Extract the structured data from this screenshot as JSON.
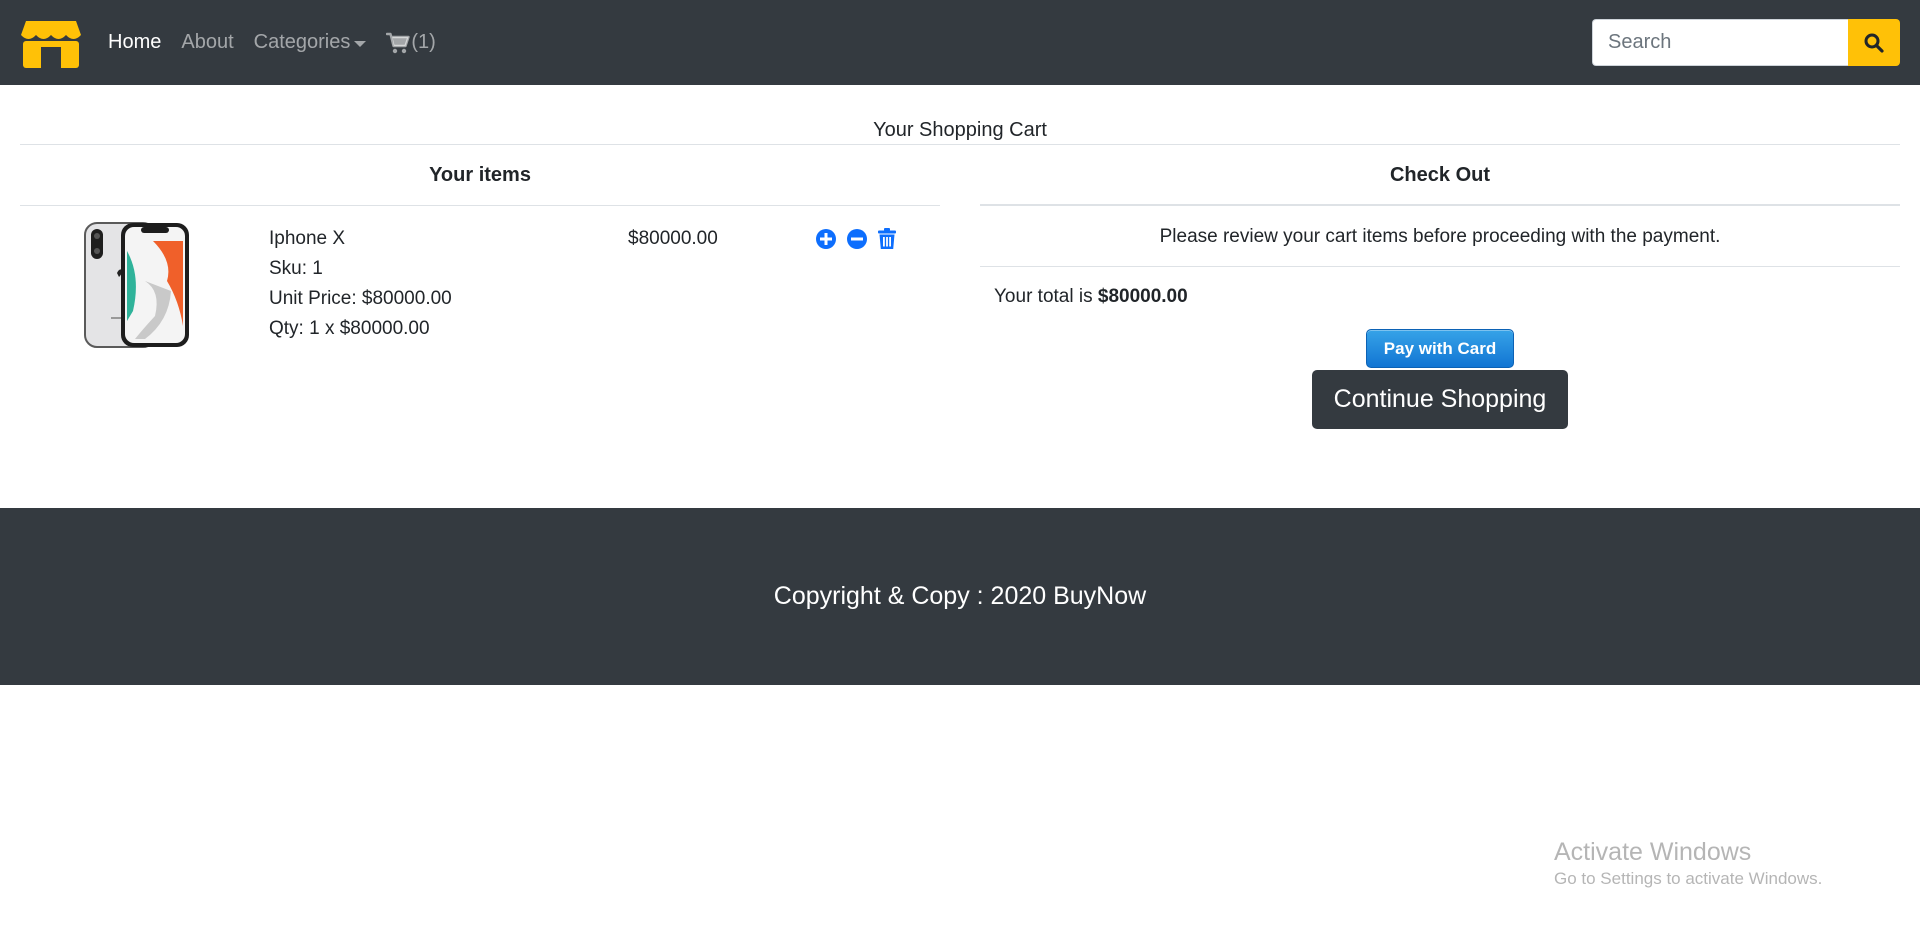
{
  "navbar": {
    "logo_icon": "storefront-icon",
    "links": [
      {
        "label": "Home",
        "active": true
      },
      {
        "label": "About",
        "active": false
      },
      {
        "label": "Categories",
        "active": false
      }
    ],
    "cart": {
      "icon": "shopping-cart-icon",
      "count_label": "(1)"
    },
    "search": {
      "placeholder": "Search",
      "button_icon": "search-icon"
    }
  },
  "cart_page": {
    "title": "Your Shopping Cart",
    "items_header": "Your items",
    "checkout_header": "Check Out",
    "items": [
      {
        "name": "Iphone X",
        "sku": "Sku: 1",
        "unit_price": "Unit Price: $80000.00",
        "qty": "Qty: 1 x $80000.00",
        "price": "$80000.00",
        "image_icon": "iphone-x-image",
        "actions": [
          "plus-circle-icon",
          "minus-circle-icon",
          "trash-icon"
        ]
      }
    ],
    "checkout": {
      "message": "Please review your cart items before proceeding with the payment.",
      "total_prefix": "Your total is ",
      "total_value": "$80000.00",
      "pay_button": "Pay with Card",
      "continue_button": "Continue Shopping"
    }
  },
  "footer": {
    "text": "Copyright & Copy : 2020 BuyNow"
  },
  "watermark": {
    "title": "Activate Windows",
    "subtitle": "Go to Settings to activate Windows."
  },
  "colors": {
    "navbar_bg": "#343a40",
    "accent_yellow": "#ffc107",
    "icon_blue": "#0d6efd",
    "pay_button_blue": "#1a82d8"
  }
}
